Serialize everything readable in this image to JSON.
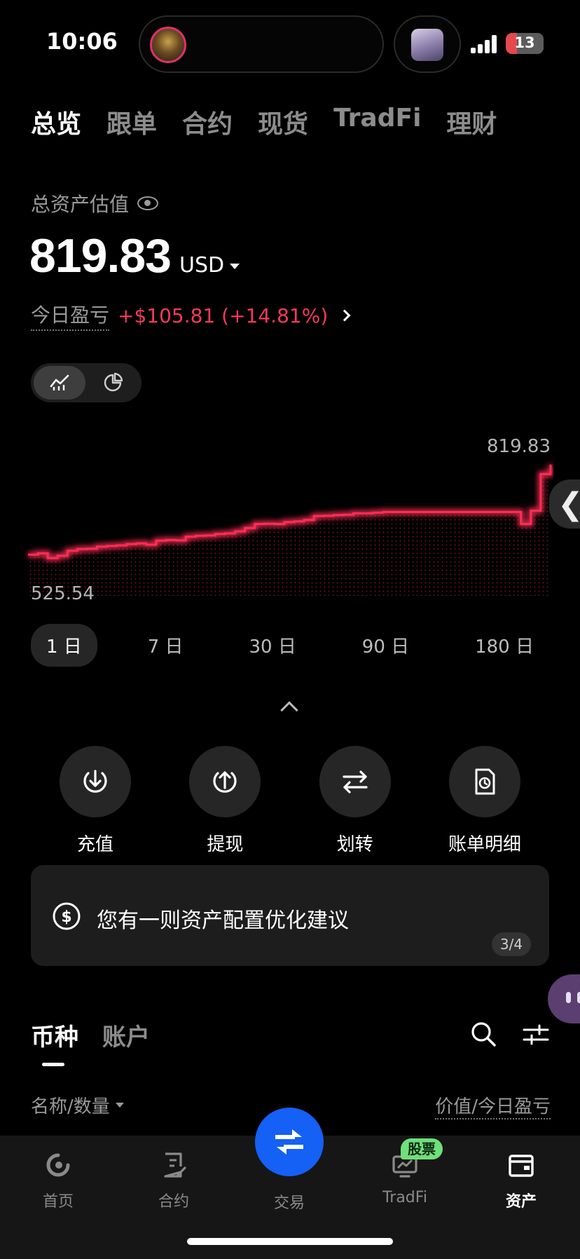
{
  "status_bar": {
    "time": "10:06",
    "battery": "13"
  },
  "top_tabs": [
    {
      "label": "总览",
      "active": true
    },
    {
      "label": "跟单",
      "active": false
    },
    {
      "label": "合约",
      "active": false
    },
    {
      "label": "现货",
      "active": false
    },
    {
      "label": "TradFi",
      "active": false
    },
    {
      "label": "理财",
      "active": false
    }
  ],
  "balance": {
    "label": "总资产估值",
    "value": "819.83",
    "currency": "USD",
    "pnl_label": "今日盈亏",
    "pnl_value": "+$105.81 (+14.81%)"
  },
  "chart_data": {
    "type": "line",
    "max_label": "819.83",
    "min_label": "525.54",
    "color": "#ff2d55",
    "ylim": [
      525.54,
      819.83
    ],
    "y": [
      548,
      552,
      538,
      545,
      560,
      565,
      566,
      572,
      574,
      576,
      580,
      582,
      578,
      590,
      592,
      591,
      602,
      605,
      606,
      610,
      612,
      618,
      628,
      640,
      641,
      640,
      646,
      648,
      652,
      664,
      665,
      667,
      668,
      672,
      672,
      674,
      676,
      676,
      676,
      676,
      676,
      676,
      676,
      676,
      676,
      676,
      676,
      676,
      676,
      676,
      640,
      680,
      790,
      818
    ]
  },
  "ranges": [
    {
      "label": "1 日",
      "active": true
    },
    {
      "label": "7 日",
      "active": false
    },
    {
      "label": "30 日",
      "active": false
    },
    {
      "label": "90 日",
      "active": false
    },
    {
      "label": "180 日",
      "active": false
    }
  ],
  "actions": [
    {
      "label": "充值",
      "icon": "deposit-icon"
    },
    {
      "label": "提现",
      "icon": "withdraw-icon"
    },
    {
      "label": "划转",
      "icon": "transfer-icon"
    },
    {
      "label": "账单明细",
      "icon": "bill-icon"
    }
  ],
  "suggestion": {
    "text": "您有一则资产配置优化建议",
    "page": "3/4"
  },
  "asset_tabs": [
    {
      "label": "币种",
      "active": true
    },
    {
      "label": "账户",
      "active": false
    }
  ],
  "list_header": {
    "left": "名称/数量",
    "right": "价值/今日盈亏"
  },
  "bottom_nav": {
    "home": "首页",
    "futures": "合约",
    "trade": "交易",
    "tradfi": "TradFi",
    "tradfi_badge": "股票",
    "assets": "资产"
  }
}
